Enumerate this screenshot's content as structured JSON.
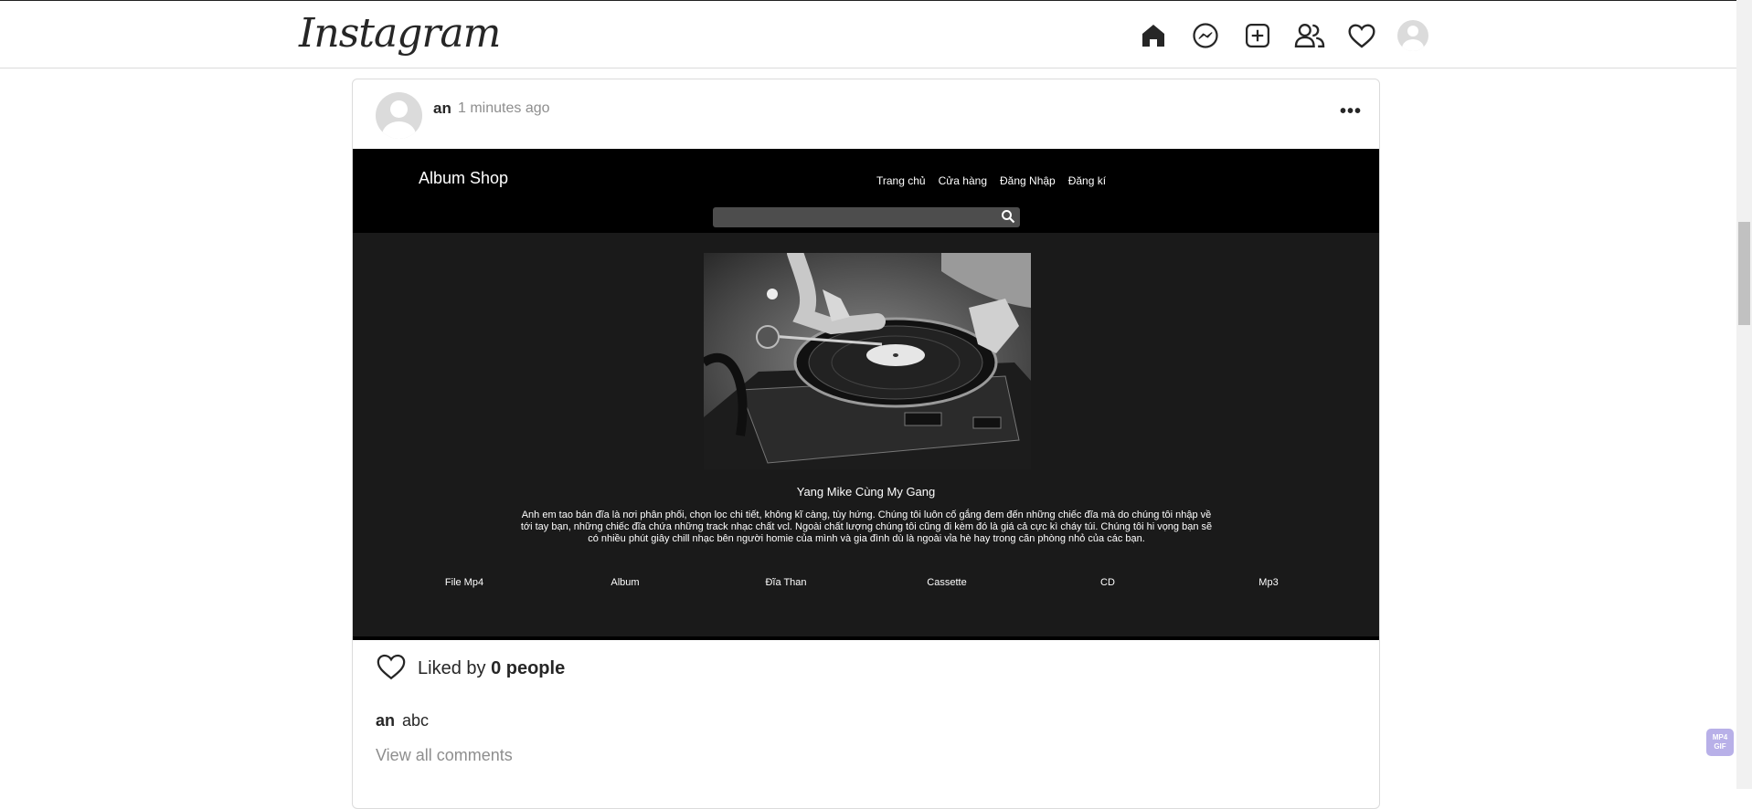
{
  "header": {
    "logo": "Instagram",
    "nav": [
      "home-icon",
      "messenger-icon",
      "new-post-icon",
      "people-icon",
      "heart-icon",
      "profile-avatar"
    ]
  },
  "post": {
    "author": "an",
    "time": "1 minutes ago",
    "more": "•••",
    "image": {
      "brand": "Album Shop",
      "nav": [
        "Trang chủ",
        "Cửa hàng",
        "Đăng Nhập",
        "Đăng kí"
      ],
      "search_placeholder": "",
      "title": "Yang Mike Cùng My Gang",
      "description": "Anh em tao bán đĩa là nơi phân phối, chọn lọc chi tiết, không kĩ càng, tùy hứng. Chúng tôi luôn cố gắng đem đến những chiếc đĩa mà do chúng tôi nhập về tới tay bạn, những chiếc đĩa chứa những track nhạc chất vcl. Ngoài chất lượng chúng tôi cũng đi kèm đó là giá cả cực kì cháy túi. Chúng tôi hi vọng bạn sẽ có nhiều phút giây chill nhạc bên người homie của mình và gia đình dù là ngoài vỉa hè hay trong căn phòng nhỏ của các bạn.",
      "categories": [
        "File Mp4",
        "Album",
        "Đĩa Than",
        "Cassette",
        "CD",
        "Mp3"
      ]
    },
    "likes_prefix": "Liked by",
    "likes_count": "0 people",
    "caption_user": "an",
    "caption_text": "abc",
    "view_all": "View all comments"
  },
  "badge": "MP4 GIF"
}
